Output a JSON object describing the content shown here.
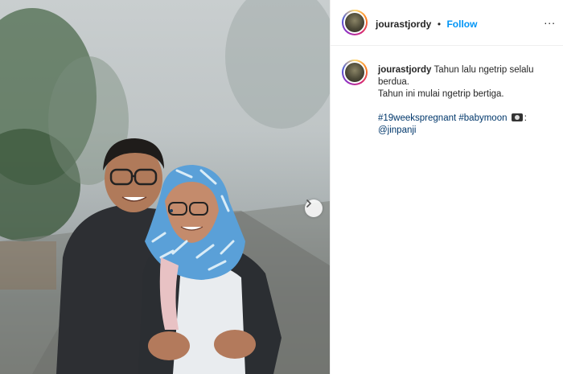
{
  "post": {
    "username": "jourastjordy",
    "follow_label": "Follow",
    "separator": "•",
    "more_label": "...",
    "caption": {
      "username": "jourastjordy",
      "line1": "Tahun lalu ngetrip selalu berdua.",
      "line2": "Tahun ini mulai ngetrip bertiga.",
      "hashtag1": "#19weekspregnant",
      "hashtag2": "#babymoon",
      "photo_credit_suffix": ":",
      "mention": "@jinpanji"
    },
    "icons": {
      "next": "chevron-right-icon",
      "camera": "camera-emoji-icon",
      "more": "more-options-icon"
    }
  },
  "colors": {
    "follow": "#0095f6",
    "link": "#00376b",
    "hijab": "#5aa0d8"
  }
}
